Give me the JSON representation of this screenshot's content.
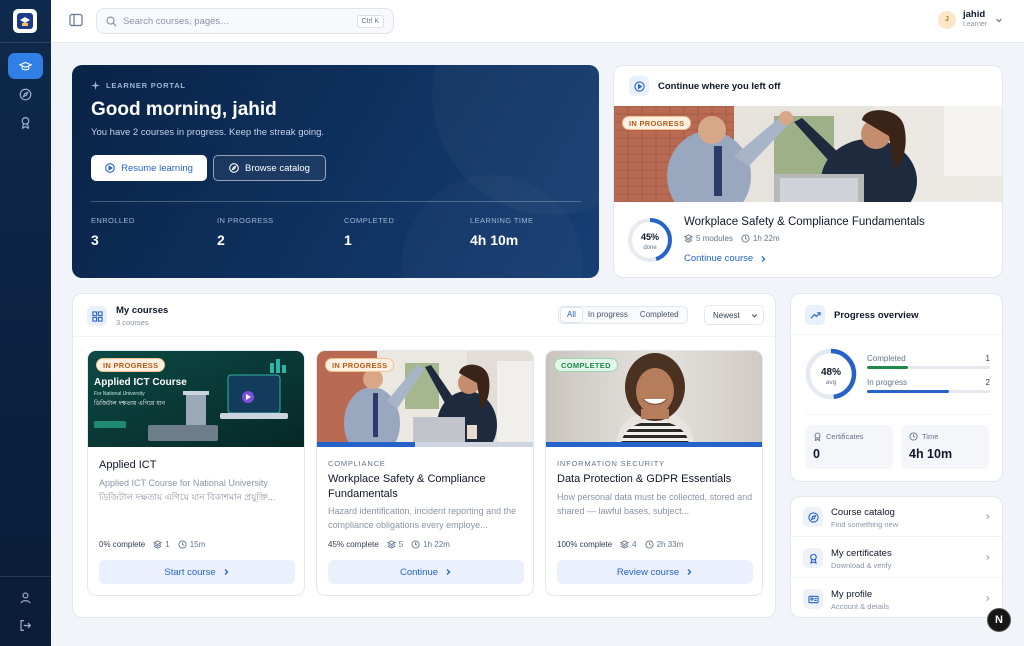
{
  "app": {
    "logo_icon": "graduation-shield-icon"
  },
  "sidebar": {
    "items": [
      {
        "icon": "graduation-cap-icon",
        "active": true
      },
      {
        "icon": "compass-icon",
        "active": false
      },
      {
        "icon": "award-icon",
        "active": false
      }
    ],
    "bottom": [
      {
        "icon": "user-icon"
      },
      {
        "icon": "logout-icon"
      }
    ]
  },
  "topbar": {
    "search_placeholder": "Search courses, pages…",
    "shortcut": "Ctrl K",
    "user_initial": "J",
    "user_name": "jahid",
    "user_role": "Learner"
  },
  "hero": {
    "tag": "LEARNER PORTAL",
    "greeting": "Good morning, jahid",
    "subtitle": "You have 2 courses in progress. Keep the streak going.",
    "resume_label": "Resume learning",
    "browse_label": "Browse catalog",
    "stats": [
      {
        "label": "ENROLLED",
        "value": "3"
      },
      {
        "label": "IN PROGRESS",
        "value": "2"
      },
      {
        "label": "COMPLETED",
        "value": "1"
      },
      {
        "label": "LEARNING TIME",
        "value": "4h 10m"
      }
    ]
  },
  "continue": {
    "title": "Continue where you left off",
    "badge": "IN PROGRESS",
    "percent_text": "45%",
    "percent_sub": "done",
    "progress": 0.45,
    "course_title": "Workplace Safety & Compliance Fundamentals",
    "modules": "5 modules",
    "duration": "1h 22m",
    "link": "Continue course"
  },
  "courses": {
    "title": "My courses",
    "count": "3 courses",
    "filters": [
      "All",
      "In progress",
      "Completed"
    ],
    "active_filter": "All",
    "sort": "Newest",
    "items": [
      {
        "badge": "IN PROGRESS",
        "badge_type": "prog",
        "image_text": {
          "title": "Applied ICT Course",
          "subtitle": "For National University",
          "bengali": "ডিজিটাল দক্ষতায় এগিয়ে যান"
        },
        "category": "",
        "title": "Applied ICT",
        "desc": "Applied ICT Course for National University ডিজিটাল দক্ষতায় এগিয়ে যান বিকাশমান প্রযুক্তি...",
        "progress": 0.0,
        "complete": "0% complete",
        "modules": "1",
        "duration": "15m",
        "button": "Start course"
      },
      {
        "badge": "IN PROGRESS",
        "badge_type": "prog",
        "category": "COMPLIANCE",
        "title": "Workplace Safety & Compliance Fundamentals",
        "desc": "Hazard identification, incident reporting and the compliance obligations every employe...",
        "progress": 0.45,
        "complete": "45% complete",
        "modules": "5",
        "duration": "1h 22m",
        "button": "Continue"
      },
      {
        "badge": "COMPLETED",
        "badge_type": "done",
        "category": "INFORMATION SECURITY",
        "title": "Data Protection & GDPR Essentials",
        "desc": "How personal data must be collected, stored and shared — lawful bases, subject...",
        "progress": 1.0,
        "complete": "100% complete",
        "modules": "4",
        "duration": "2h 33m",
        "button": "Review course"
      }
    ]
  },
  "overview": {
    "title": "Progress overview",
    "avg_text": "48%",
    "avg_sub": "avg",
    "avg": 0.48,
    "rows": [
      {
        "label": "Completed",
        "count": "1",
        "fraction": 0.33,
        "color": "#1f8a4c"
      },
      {
        "label": "In progress",
        "count": "2",
        "fraction": 0.67,
        "color": "#2563c9"
      }
    ],
    "certificates_label": "Certificates",
    "certificates_value": "0",
    "time_label": "Time",
    "time_value": "4h 10m"
  },
  "links": [
    {
      "title": "Course catalog",
      "sub": "Find something new",
      "icon": "compass-icon"
    },
    {
      "title": "My certificates",
      "sub": "Download & verify",
      "icon": "award-icon"
    },
    {
      "title": "My profile",
      "sub": "Account & details",
      "icon": "id-card-icon"
    }
  ],
  "corner_badge": "N",
  "colors": {
    "accent": "#2563c9",
    "hero": "#0f3261",
    "sidebar": "#0b2140",
    "progress_badge": "#b85b18",
    "completed_badge": "#1f8a4c"
  }
}
